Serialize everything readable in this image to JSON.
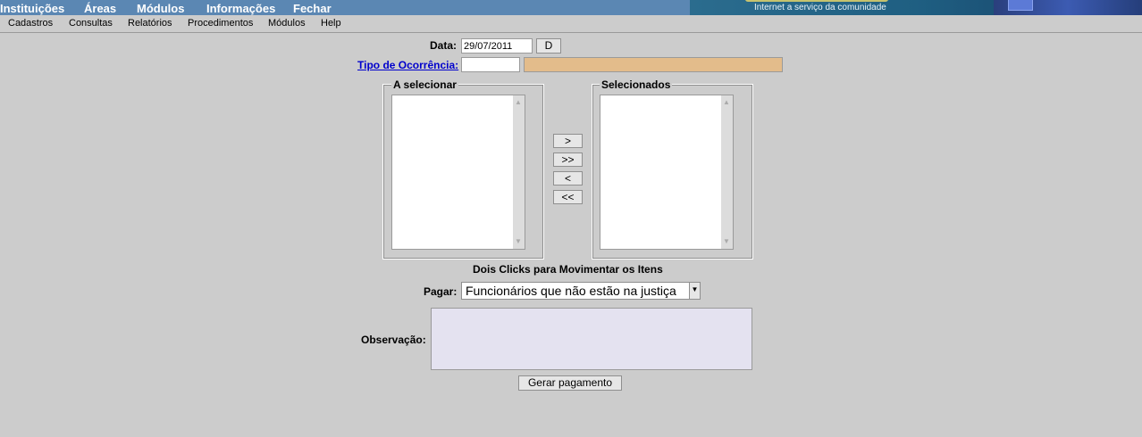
{
  "top_menu": [
    "Instituições",
    "Áreas",
    "Módulos",
    "Informações",
    "Fechar"
  ],
  "banner": {
    "tagline": "Internet a serviço da comunidade"
  },
  "sub_menu": [
    "Cadastros",
    "Consultas",
    "Relatórios",
    "Procedimentos",
    "Módulos",
    "Help"
  ],
  "form": {
    "data_label": "Data:",
    "data_value": "29/07/2011",
    "data_button": "D",
    "tipo_label": "Tipo de Ocorrência:",
    "tipo_code": "",
    "tipo_desc": "",
    "a_selecionar_legend": "A selecionar",
    "selecionados_legend": "Selecionados",
    "move_buttons": [
      ">",
      ">>",
      "<",
      "<<"
    ],
    "hint": "Dois Clicks para Movimentar os Itens",
    "pagar_label": "Pagar:",
    "pagar_value": "Funcionários que não estão na justiça",
    "obs_label": "Observação:",
    "obs_value": "",
    "submit_label": "Gerar pagamento"
  },
  "colors": {
    "topbar": "#5b87b3",
    "tipo_desc_bg": "#e3bc8b",
    "obs_bg": "#e4e2f0",
    "link": "#0000cc"
  }
}
